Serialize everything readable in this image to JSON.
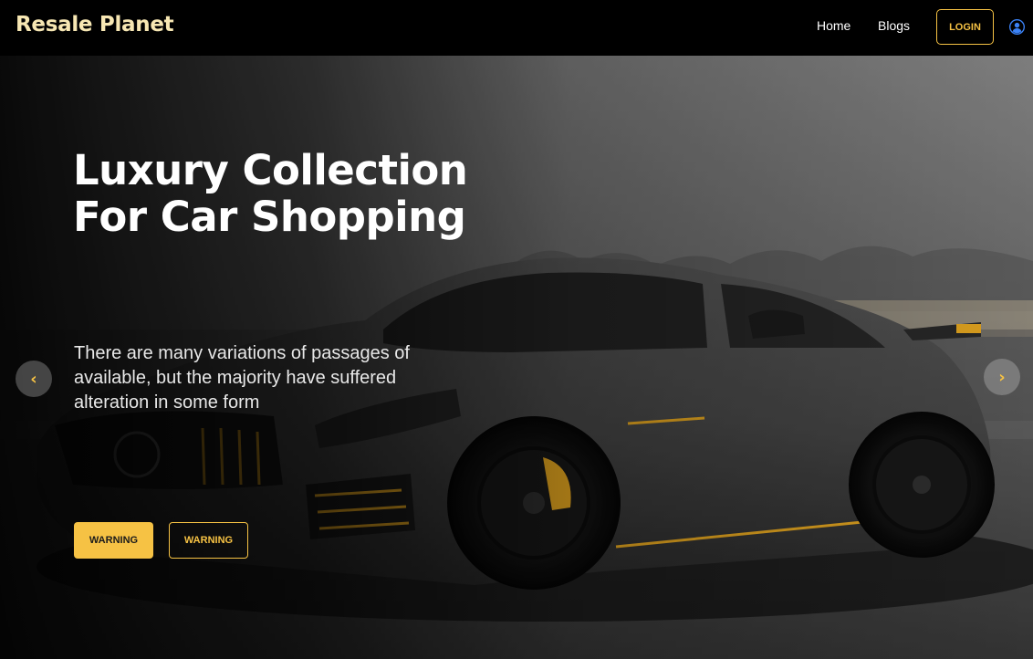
{
  "header": {
    "brand": "Resale Planet",
    "nav": {
      "home": "Home",
      "blogs": "Blogs"
    },
    "login_label": "LOGIN",
    "user_icon": "user-circle-icon"
  },
  "hero": {
    "title": "Luxury Collection For Car Shopping",
    "description": "There are many variations of passages of available, but the majority have suffered alteration in some form",
    "buttons": {
      "primary_label": "WARNING",
      "secondary_label": "WARNING"
    },
    "prev_arrow": "‹",
    "next_arrow": "›",
    "image": "grey-sports-car"
  },
  "colors": {
    "accent": "#f6c244",
    "brand_text": "#f7e7b3",
    "navbar_bg": "#000000",
    "user_icon": "#3b82f6"
  }
}
